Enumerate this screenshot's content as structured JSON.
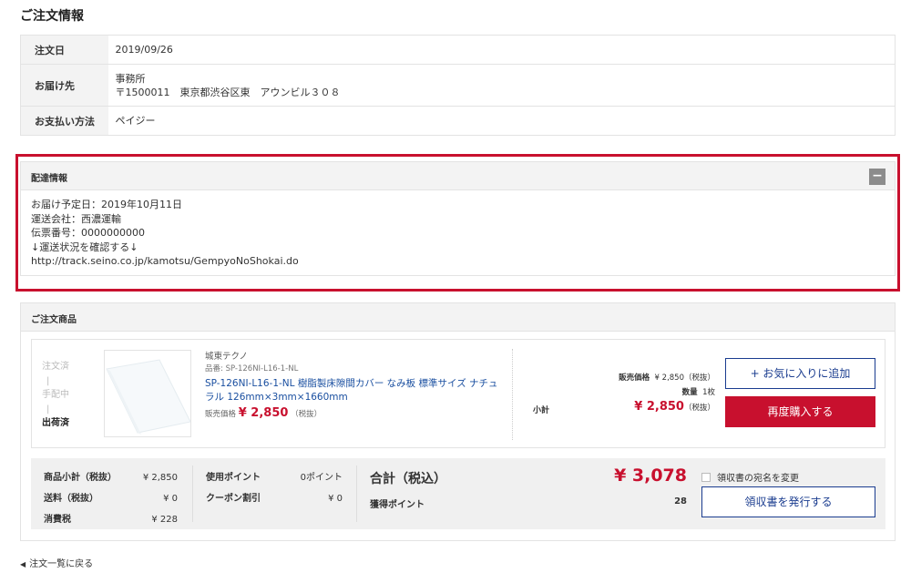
{
  "page_title": "ご注文情報",
  "order_info": {
    "order_date_label": "注文日",
    "order_date": "2019/09/26",
    "destination_label": "お届け先",
    "destination_name": "事務所",
    "destination_address": "〒1500011　東京都渋谷区東　アウンビル３０８",
    "payment_label": "お支払い方法",
    "payment_method": "ペイジー"
  },
  "delivery": {
    "title": "配達情報",
    "collapse_symbol": "−",
    "lines": [
      "お届け予定日：2019年10月11日",
      "運送会社：西濃運輸",
      "伝票番号：0000000000",
      "↓運送状況を確認する↓",
      "http://track.seino.co.jp/kamotsu/GempyoNoShokai.do"
    ]
  },
  "products": {
    "title": "ご注文商品",
    "steps": [
      "注文済",
      "|",
      "手配中",
      "|",
      "出荷済"
    ],
    "item": {
      "maker": "城東テクノ",
      "code": "品番: SP-126NI-L16-1-NL",
      "name": "SP-126NI-L16-1-NL 樹脂製床隙間カバー なみ板 標準サイズ ナチュラル 126mm×3mm×1660mm",
      "price_label": "販売価格",
      "price": "¥ 2,850",
      "price_tax_note": "（税抜）",
      "unit_price_label": "販売価格",
      "unit_price": "¥ 2,850（税抜）",
      "qty_label": "数量",
      "qty": "1枚",
      "subtotal_label": "小計",
      "subtotal": "¥ 2,850",
      "subtotal_tax_note": "（税抜）",
      "fav_button": "+ お気に入りに追加",
      "rebuy_button": "再度購入する"
    }
  },
  "summary": {
    "subtotal_label": "商品小計（税抜）",
    "subtotal": "¥ 2,850",
    "shipping_label": "送料（税抜）",
    "shipping": "¥ 0",
    "tax_label": "消費税",
    "tax": "¥ 228",
    "points_used_label": "使用ポイント",
    "points_used": "0ポイント",
    "coupon_label": "クーポン割引",
    "coupon": "¥ 0",
    "total_label": "合計（税込）",
    "total": "¥ 3,078",
    "earned_points_label": "獲得ポイント",
    "earned_points": "28",
    "receipt_change_label": "領収書の宛名を変更",
    "receipt_button": "領収書を発行する"
  },
  "back_link": "注文一覧に戻る",
  "colors": {
    "accent_red": "#c8102e",
    "navy": "#1a3c8f",
    "link_blue": "#1a4fa0"
  }
}
